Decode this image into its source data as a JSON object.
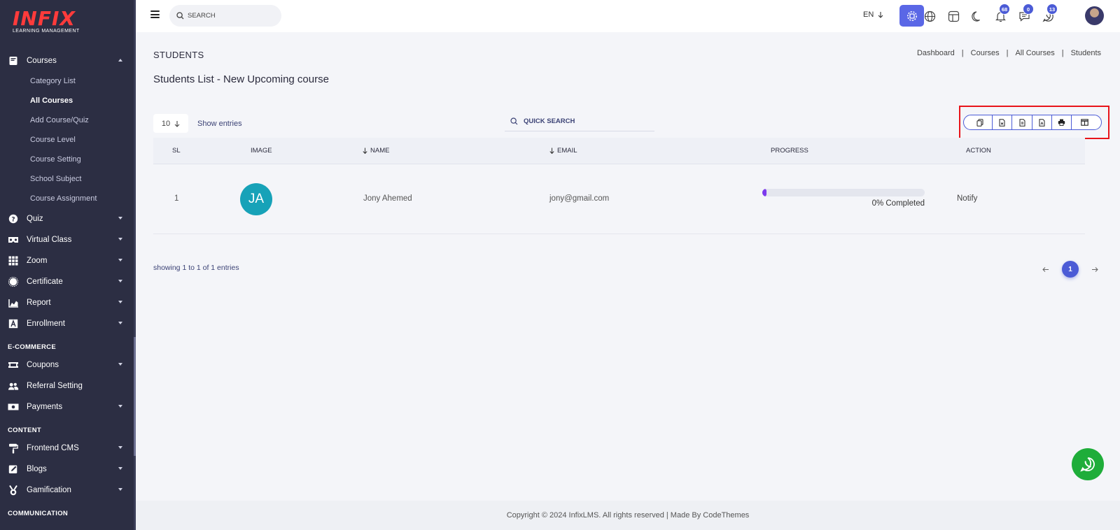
{
  "brand": {
    "logo_text": "INFIX",
    "logo_sub": "LEARNING MANAGEMENT"
  },
  "sidebar": {
    "courses": {
      "label": "Courses",
      "icon": "book-icon",
      "sub_items": [
        {
          "label": "Category List",
          "active": false
        },
        {
          "label": "All Courses",
          "active": true
        },
        {
          "label": "Add Course/Quiz",
          "active": false
        },
        {
          "label": "Course Level",
          "active": false
        },
        {
          "label": "Course Setting",
          "active": false
        },
        {
          "label": "School Subject",
          "active": false
        },
        {
          "label": "Course Assignment",
          "active": false
        }
      ]
    },
    "items_a": [
      {
        "label": "Quiz",
        "icon": "question-circle-icon"
      },
      {
        "label": "Virtual Class",
        "icon": "vr-icon"
      },
      {
        "label": "Zoom",
        "icon": "grid-icon"
      },
      {
        "label": "Certificate",
        "icon": "certificate-icon"
      },
      {
        "label": "Report",
        "icon": "chart-icon"
      },
      {
        "label": "Enrollment",
        "icon": "enrollment-icon"
      }
    ],
    "section_ecommerce": "E-COMMERCE",
    "items_b": [
      {
        "label": "Coupons",
        "icon": "ticket-icon",
        "caret": true
      },
      {
        "label": "Referral Setting",
        "icon": "users-icon",
        "caret": false
      },
      {
        "label": "Payments",
        "icon": "money-icon",
        "caret": true
      }
    ],
    "section_content": "CONTENT",
    "items_c": [
      {
        "label": "Frontend CMS",
        "icon": "paint-roller-icon"
      },
      {
        "label": "Blogs",
        "icon": "pencil-square-icon"
      },
      {
        "label": "Gamification",
        "icon": "medal-icon"
      }
    ],
    "section_communication": "COMMUNICATION"
  },
  "header": {
    "search_placeholder": "SEARCH",
    "language": "EN",
    "notifications_count": "68",
    "messages_count": "0",
    "whatsapp_count": "13"
  },
  "page": {
    "title": "STUDENTS",
    "breadcrumb": [
      "Dashboard",
      "Courses",
      "All Courses",
      "Students"
    ],
    "subtitle": "Students List - New Upcoming course"
  },
  "controls": {
    "entries_value": "10",
    "show_entries_label": "Show entries",
    "quick_search_placeholder": "QUICK SEARCH",
    "export_buttons": [
      "copy-icon",
      "csv-file-icon",
      "excel-file-icon",
      "pdf-file-icon",
      "print-icon",
      "columns-icon"
    ]
  },
  "table": {
    "headers": {
      "sl": "SL",
      "image": "IMAGE",
      "name": "NAME",
      "email": "EMAIL",
      "progress": "PROGRESS",
      "action": "ACTION"
    },
    "rows": [
      {
        "sl": "1",
        "initials": "JA",
        "name": "Jony Ahemed",
        "email": "jony@gmail.com",
        "progress_pct": 0,
        "progress_text": "0% Completed",
        "action": "Notify"
      }
    ]
  },
  "pagination": {
    "showing": "showing 1 to 1 of 1 entries",
    "current_page": "1"
  },
  "footer": {
    "text": "Copyright © 2024 InfixLMS. All rights reserved | Made By CodeThemes"
  },
  "colors": {
    "sidebar_bg": "#2c2e43",
    "accent": "#4b5bd6",
    "progress": "#7c3aed",
    "avatar": "#17a2b8",
    "whatsapp": "#1fad3a",
    "highlight": "#e8141a"
  }
}
